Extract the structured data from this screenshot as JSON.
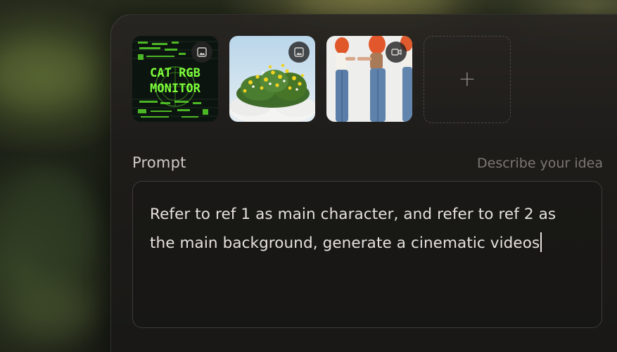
{
  "references": [
    {
      "id": "ref-1",
      "kind": "image",
      "thumb_text": [
        "CAT RGB",
        "MONITOR"
      ],
      "badge_icon": "image-icon"
    },
    {
      "id": "ref-2",
      "kind": "image",
      "badge_icon": "image-icon"
    },
    {
      "id": "ref-3",
      "kind": "video",
      "badge_icon": "video-camera-icon"
    }
  ],
  "add_reference": {
    "symbol": "+"
  },
  "prompt": {
    "label": "Prompt",
    "hint": "Describe your idea",
    "value": "Refer to ref 1 as main character, and refer to ref 2 as the main background, generate a cinematic videos"
  },
  "colors": {
    "panel_bg": "#1e1c1a",
    "text_primary": "#e7e3de",
    "text_muted": "#7b7874",
    "terminal_green": "#7dff3a"
  }
}
